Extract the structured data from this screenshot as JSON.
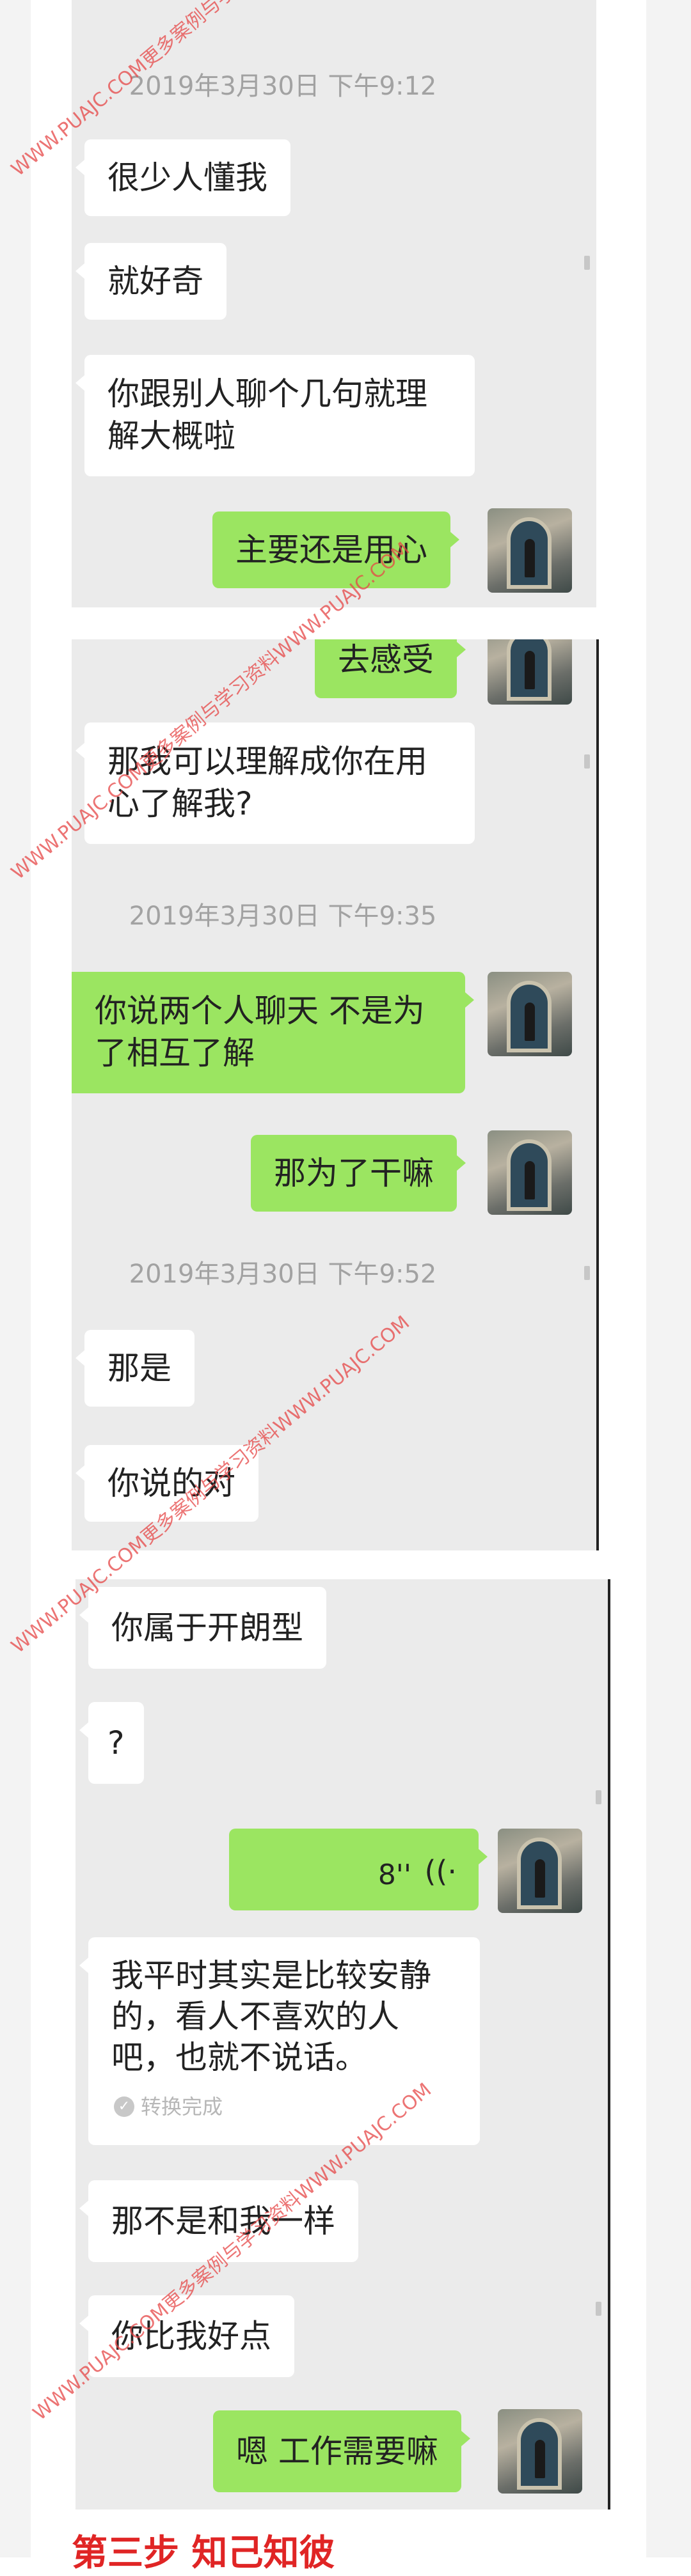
{
  "panel1": {
    "timestamp_1": "2019年3月30日 下午9:12",
    "msg_1": "很少人懂我",
    "msg_2": "就好奇",
    "msg_3": "你跟别人聊个几句就理解大概啦",
    "msg_4": "主要还是用心"
  },
  "panel2": {
    "msg_1": "去感受",
    "msg_2": "那我可以理解成你在用心了解我?",
    "timestamp_1": "2019年3月30日 下午9:35",
    "msg_3": "你说两个人聊天 不是为了相互了解",
    "msg_4": "那为了干嘛",
    "timestamp_2": "2019年3月30日 下午9:52",
    "msg_5": "那是",
    "msg_6": "你说的对"
  },
  "panel3": {
    "msg_1": "你属于开朗型",
    "msg_2": "?",
    "voice_duration": "8''",
    "voice_icon": "((·",
    "msg_3": "我平时其实是比较安静的，看人不喜欢的人吧，也就不说话。",
    "conversion_status": "转换完成",
    "msg_4": "那不是和我一样",
    "msg_5": "你比我好点",
    "msg_6": "嗯 工作需要嘛"
  },
  "section_heading": "第三步 知己知彼",
  "watermarks": [
    "WWW.PUAJC.COM更多案例与学习资料WWW.PUAJC.COM",
    "WWW.PUAJC.COM更多案例与学习资料WWW.PUAJC.COM",
    "WWW.PUAJC.COM更多案例与学习资料WWW.PUAJC.COM",
    "WWW.PUAJC.COM更多案例与学习资料WWW.PUAJC.COM"
  ],
  "colors": {
    "chat_background": "#ebebeb",
    "incoming_bubble": "#ffffff",
    "outgoing_bubble": "#9be561",
    "heading_red": "#e02525"
  }
}
